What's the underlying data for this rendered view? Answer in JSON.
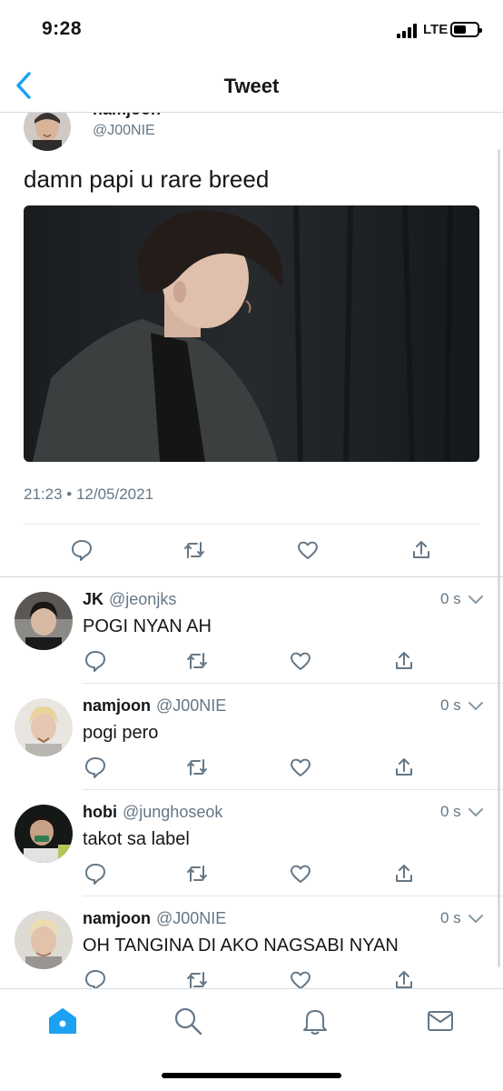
{
  "status_bar": {
    "time": "9:28",
    "network": "LTE",
    "battery_level": 0.55
  },
  "nav": {
    "title": "Tweet",
    "back_icon": "chevron-left-icon"
  },
  "main_tweet": {
    "author_name": "namjoon",
    "author_handle": "@J00NIE",
    "text": "damn papi u  rare breed",
    "timestamp": "21:23 • 12/05/2021",
    "actions": [
      "reply-icon",
      "retweet-icon",
      "like-icon",
      "share-icon"
    ]
  },
  "replies": [
    {
      "name": "JK",
      "handle": "@jeonjks",
      "time": "0 s",
      "text": "POGI NYAN AH"
    },
    {
      "name": "namjoon",
      "handle": "@J00NIE",
      "time": "0 s",
      "text": "pogi pero"
    },
    {
      "name": "hobi",
      "handle": "@junghoseok",
      "time": "0 s",
      "text": "takot sa label"
    },
    {
      "name": "namjoon",
      "handle": "@J00NIE",
      "time": "0 s",
      "text": "OH TANGINA DI AKO NAGSABI NYAN"
    }
  ],
  "tab_bar": {
    "tabs": [
      "home-icon",
      "search-icon",
      "bell-icon",
      "mail-icon"
    ],
    "active": "home-icon"
  },
  "colors": {
    "accent": "#1da1f2",
    "icon_gray": "#657786",
    "divider": "#e1e8ed"
  }
}
